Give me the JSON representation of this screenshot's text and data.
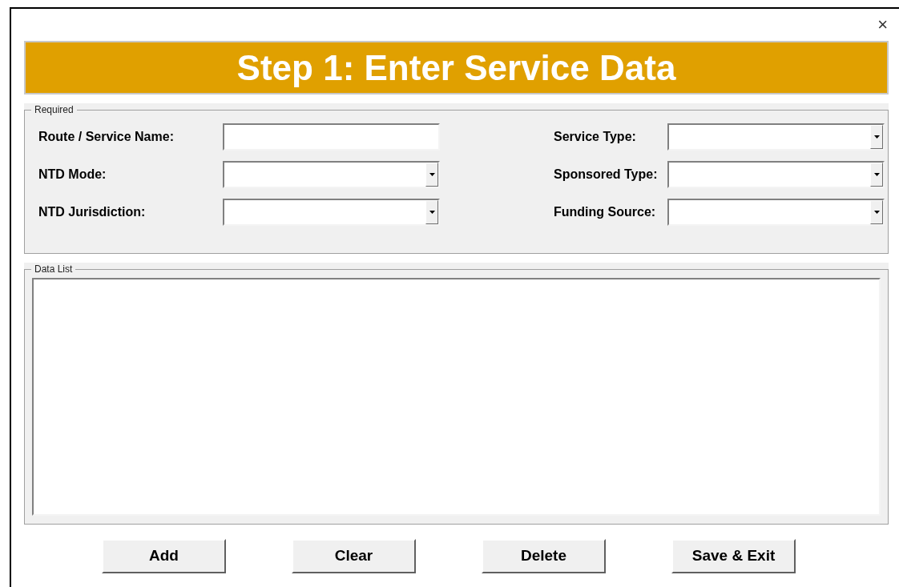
{
  "window": {
    "close": "×"
  },
  "banner": {
    "title": "Step 1: Enter Service Data"
  },
  "required": {
    "legend": "Required",
    "fields": [
      {
        "label": "Route / Service Name:",
        "kind": "text"
      },
      {
        "label": "Service Type:",
        "kind": "dropdown"
      },
      {
        "label": "NTD Mode:",
        "kind": "dropdown"
      },
      {
        "label": "Sponsored Type:",
        "kind": "dropdown"
      },
      {
        "label": "NTD Jurisdiction:",
        "kind": "dropdown"
      },
      {
        "label": "Funding Source:",
        "kind": "dropdown"
      }
    ]
  },
  "data_list": {
    "legend": "Data List"
  },
  "buttons": [
    "Add",
    "Clear",
    "Delete",
    "Save & Exit"
  ]
}
